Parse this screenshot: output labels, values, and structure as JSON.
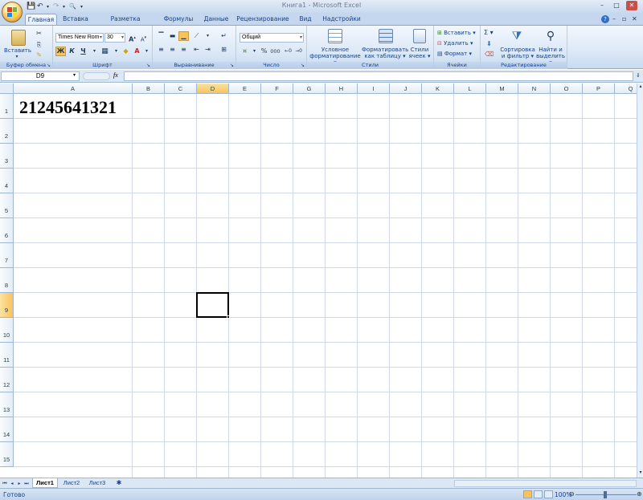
{
  "window": {
    "title": "Книга1 - Microsoft Excel",
    "minimize": "–",
    "maximize": "□",
    "close": "✕",
    "doc_minimize": "–",
    "doc_restore": "▫",
    "doc_close": "✕",
    "help": "?"
  },
  "qat": {
    "save": "💾",
    "undo": "↶",
    "redo": "↷",
    "preview": "🔍",
    "more": "▾"
  },
  "tabs": [
    "Главная",
    "Вставка",
    "Разметка страницы",
    "Формулы",
    "Данные",
    "Рецензирование",
    "Вид",
    "Надстройки"
  ],
  "ribbon": {
    "clipboard": {
      "paste": "Вставить",
      "label": "Буфер обмена"
    },
    "font": {
      "name": "Times New Rom",
      "size": "30",
      "bold": "Ж",
      "italic": "К",
      "underline": "Ч",
      "label": "Шрифт"
    },
    "alignment": {
      "label": "Выравнивание"
    },
    "number": {
      "format": "Общий",
      "percent": "%",
      "thousands": "000",
      "label": "Число"
    },
    "styles": {
      "conditional_1": "Условное",
      "conditional_2": "форматирование ▾",
      "table_1": "Форматировать",
      "table_2": "как таблицу ▾",
      "cell_1": "Стили",
      "cell_2": "ячеек ▾",
      "label": "Стили"
    },
    "cells": {
      "insert": "Вставить ▾",
      "delete": "Удалить ▾",
      "format": "Формат ▾",
      "label": "Ячейки"
    },
    "editing": {
      "sum": "Σ ▾",
      "sort_1": "Сортировка",
      "sort_2": "и фильтр ▾",
      "find_1": "Найти и",
      "find_2": "выделить ▾",
      "label": "Редактирование"
    }
  },
  "formula_bar": {
    "name_box": "D9",
    "fx": "fx",
    "content": ""
  },
  "grid": {
    "columns": [
      "A",
      "B",
      "C",
      "D",
      "E",
      "F",
      "G",
      "H",
      "I",
      "J",
      "K",
      "L",
      "M",
      "N",
      "O",
      "P",
      "Q"
    ],
    "rows": [
      "1",
      "2",
      "3",
      "4",
      "5",
      "6",
      "7",
      "8",
      "9",
      "10",
      "11",
      "12",
      "13",
      "14",
      "15"
    ],
    "selected_column": "D",
    "selected_row": "9",
    "cells": {
      "A1": "21245641321"
    }
  },
  "sheets": {
    "tabs": [
      "Лист1",
      "Лист2",
      "Лист3"
    ],
    "active": "Лист1"
  },
  "status": {
    "text": "Готово",
    "zoom": "100%"
  },
  "colors": {
    "accent": "#15428b",
    "ribbon": "#dde9f7",
    "selection_header": "#f9c25b"
  }
}
